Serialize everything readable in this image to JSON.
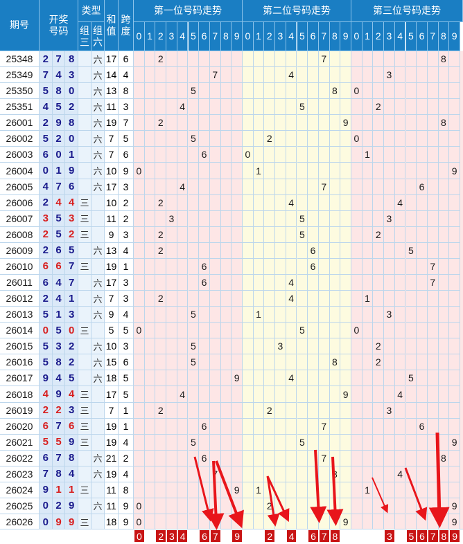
{
  "header": {
    "period": "期号",
    "draw": "开奖\n号码",
    "type": "类型",
    "type_zu3": "组\n三",
    "type_zu6": "组\n六",
    "sum": "和\n值",
    "span": "跨\n度",
    "pos1": "第一位号码走势",
    "pos2": "第二位号码走势",
    "pos3": "第三位号码走势",
    "digits": [
      "0",
      "1",
      "2",
      "3",
      "4",
      "5",
      "6",
      "7",
      "8",
      "9"
    ]
  },
  "type_labels": {
    "zu3": "三",
    "zu6": "六"
  },
  "rows": [
    {
      "period": "25348",
      "d": [
        2,
        7,
        8
      ],
      "type": "zu6",
      "sum": 17,
      "span": 6
    },
    {
      "period": "25349",
      "d": [
        7,
        4,
        3
      ],
      "type": "zu6",
      "sum": 14,
      "span": 4
    },
    {
      "period": "25350",
      "d": [
        5,
        8,
        0
      ],
      "type": "zu6",
      "sum": 13,
      "span": 8
    },
    {
      "period": "25351",
      "d": [
        4,
        5,
        2
      ],
      "type": "zu6",
      "sum": 11,
      "span": 3
    },
    {
      "period": "26001",
      "d": [
        2,
        9,
        8
      ],
      "type": "zu6",
      "sum": 19,
      "span": 7
    },
    {
      "period": "26002",
      "d": [
        5,
        2,
        0
      ],
      "type": "zu6",
      "sum": 7,
      "span": 5
    },
    {
      "period": "26003",
      "d": [
        6,
        0,
        1
      ],
      "type": "zu6",
      "sum": 7,
      "span": 6
    },
    {
      "period": "26004",
      "d": [
        0,
        1,
        9
      ],
      "type": "zu6",
      "sum": 10,
      "span": 9
    },
    {
      "period": "26005",
      "d": [
        4,
        7,
        6
      ],
      "type": "zu6",
      "sum": 17,
      "span": 3
    },
    {
      "period": "26006",
      "d": [
        2,
        4,
        4
      ],
      "type": "zu3",
      "sum": 10,
      "span": 2
    },
    {
      "period": "26007",
      "d": [
        3,
        5,
        3
      ],
      "type": "zu3",
      "sum": 11,
      "span": 2
    },
    {
      "period": "26008",
      "d": [
        2,
        5,
        2
      ],
      "type": "zu3",
      "sum": 9,
      "span": 3
    },
    {
      "period": "26009",
      "d": [
        2,
        6,
        5
      ],
      "type": "zu6",
      "sum": 13,
      "span": 4
    },
    {
      "period": "26010",
      "d": [
        6,
        6,
        7
      ],
      "type": "zu3",
      "sum": 19,
      "span": 1
    },
    {
      "period": "26011",
      "d": [
        6,
        4,
        7
      ],
      "type": "zu6",
      "sum": 17,
      "span": 3
    },
    {
      "period": "26012",
      "d": [
        2,
        4,
        1
      ],
      "type": "zu6",
      "sum": 7,
      "span": 3
    },
    {
      "period": "26013",
      "d": [
        5,
        1,
        3
      ],
      "type": "zu6",
      "sum": 9,
      "span": 4
    },
    {
      "period": "26014",
      "d": [
        0,
        5,
        0
      ],
      "type": "zu3",
      "sum": 5,
      "span": 5
    },
    {
      "period": "26015",
      "d": [
        5,
        3,
        2
      ],
      "type": "zu6",
      "sum": 10,
      "span": 3
    },
    {
      "period": "26016",
      "d": [
        5,
        8,
        2
      ],
      "type": "zu6",
      "sum": 15,
      "span": 6
    },
    {
      "period": "26017",
      "d": [
        9,
        4,
        5
      ],
      "type": "zu6",
      "sum": 18,
      "span": 5
    },
    {
      "period": "26018",
      "d": [
        4,
        9,
        4
      ],
      "type": "zu3",
      "sum": 17,
      "span": 5
    },
    {
      "period": "26019",
      "d": [
        2,
        2,
        3
      ],
      "type": "zu3",
      "sum": 7,
      "span": 1
    },
    {
      "period": "26020",
      "d": [
        6,
        7,
        6
      ],
      "type": "zu3",
      "sum": 19,
      "span": 1
    },
    {
      "period": "26021",
      "d": [
        5,
        5,
        9
      ],
      "type": "zu3",
      "sum": 19,
      "span": 4
    },
    {
      "period": "26022",
      "d": [
        6,
        7,
        8
      ],
      "type": "zu6",
      "sum": 21,
      "span": 2
    },
    {
      "period": "26023",
      "d": [
        7,
        8,
        4
      ],
      "type": "zu6",
      "sum": 19,
      "span": 4
    },
    {
      "period": "26024",
      "d": [
        9,
        1,
        1
      ],
      "type": "zu3",
      "sum": 11,
      "span": 8
    },
    {
      "period": "26025",
      "d": [
        0,
        2,
        9
      ],
      "type": "zu6",
      "sum": 11,
      "span": 9
    },
    {
      "period": "26026",
      "d": [
        0,
        9,
        9
      ],
      "type": "zu3",
      "sum": 18,
      "span": 9
    }
  ],
  "footer_picks": {
    "pos1": [
      "0",
      "",
      "2",
      "3",
      "4",
      "",
      "6",
      "7",
      "",
      "9"
    ],
    "pos2": [
      "",
      "",
      "2",
      "",
      "4",
      "",
      "6",
      "7",
      "8",
      ""
    ],
    "pos3": [
      "",
      "",
      "",
      "3",
      "",
      "5",
      "6",
      "7",
      "8",
      "9"
    ]
  },
  "colors": {
    "header_blue": "#1a7ec3",
    "pos1_band": "#fde6e6",
    "pos2_band": "#fdfbe0",
    "pos3_band": "#fde6e6",
    "draw_blue": "#1a1a8c",
    "draw_repeat_red": "#d81e1e",
    "arrow_red": "#e8151b",
    "footer_red": "#c81414"
  }
}
